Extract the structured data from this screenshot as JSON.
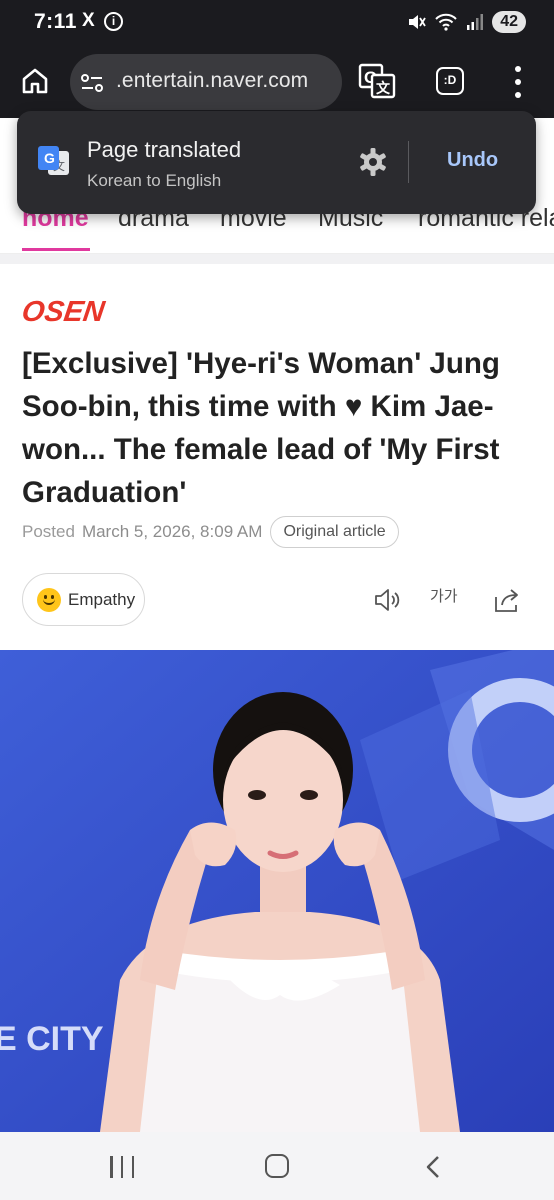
{
  "status_bar": {
    "time": "7:11",
    "x_icon": "X",
    "info_icon": "i",
    "battery": "42"
  },
  "toolbar": {
    "url": ".entertain.naver.com",
    "tabs_label": ":D"
  },
  "translate_popup": {
    "title": "Page translated",
    "subtitle": "Korean to English",
    "undo": "Undo",
    "logo_letter": "G"
  },
  "tabs": [
    {
      "label": "home",
      "active": true
    },
    {
      "label": "drama",
      "active": false
    },
    {
      "label": "movie",
      "active": false
    },
    {
      "label": "Music",
      "active": false
    },
    {
      "label": "romantic rela",
      "active": false
    }
  ],
  "article": {
    "publisher": "OSEN",
    "headline": "[Exclusive] 'Hye-ri's Woman' Jung Soo-bin, this time with ♥ Kim Jae-won... The female lead of 'My First Graduation'",
    "posted_label": "Posted",
    "posted_date": "March 5, 2026, 8:09 AM",
    "original_article": "Original article",
    "empathy": "Empathy",
    "font_size_label": "가가",
    "photo_backdrop_text": "E CITY"
  },
  "colors": {
    "accent_pink": "#e0399e",
    "osen_red": "#e8362a",
    "undo_blue": "#a8c7fa",
    "toolbar_bg": "#1b1b1f"
  }
}
